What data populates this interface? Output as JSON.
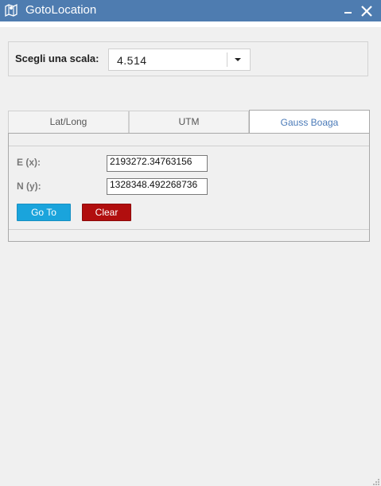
{
  "window": {
    "title": "GotoLocation",
    "app_icon": "map-icon",
    "minimize_icon": "minimize-icon",
    "close_icon": "close-icon",
    "title_bar_color": "#4e7cb0"
  },
  "scale": {
    "label": "Scegli una scala:",
    "selected_value": "4.514",
    "dropdown_icon": "chevron-down-icon"
  },
  "tabs": [
    {
      "label": "Lat/Long",
      "active": false
    },
    {
      "label": "UTM",
      "active": false
    },
    {
      "label": "Gauss Boaga",
      "active": true
    }
  ],
  "gauss_boaga": {
    "e_label": "E (x):",
    "e_value": "2193272.34763156",
    "n_label": "N (y):",
    "n_value": "1328348.492268736"
  },
  "buttons": {
    "goto_label": "Go To",
    "goto_color": "#1aa4dc",
    "clear_label": "Clear",
    "clear_color": "#b10e0e"
  }
}
